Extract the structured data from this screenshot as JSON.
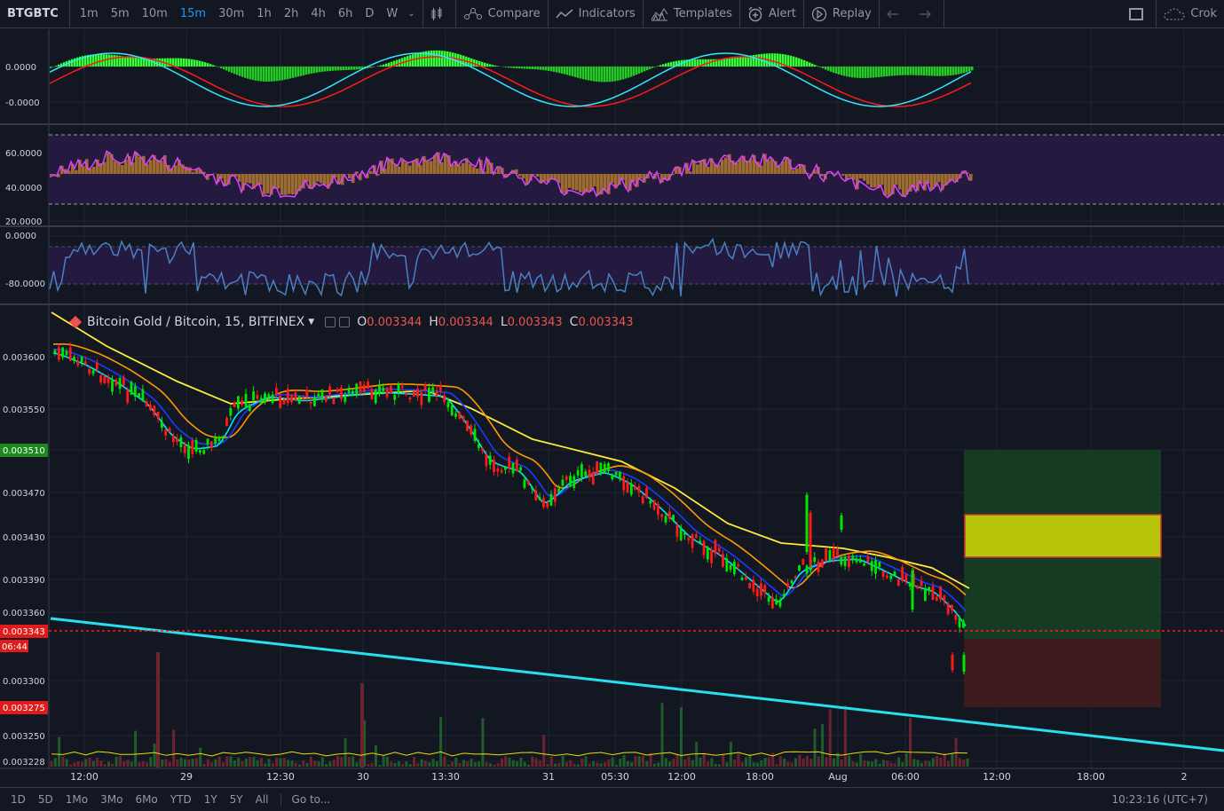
{
  "toolbar": {
    "symbol": "BTGBTC",
    "intervals": [
      "1m",
      "5m",
      "10m",
      "15m",
      "30m",
      "1h",
      "2h",
      "4h",
      "6h",
      "D",
      "W"
    ],
    "active_interval": "15m",
    "compare_label": "Compare",
    "indicators_label": "Indicators",
    "templates_label": "Templates",
    "alert_label": "Alert",
    "replay_label": "Replay",
    "right_label": "Crok"
  },
  "legend": {
    "title": "Bitcoin Gold / Bitcoin, 15, BITFINEX",
    "o_label": "O",
    "o_value": "0.003344",
    "h_label": "H",
    "h_value": "0.003344",
    "l_label": "L",
    "l_value": "0.003343",
    "c_label": "C",
    "c_value": "0.003343"
  },
  "panes": {
    "macd_labels": [
      "0.0000",
      "-0.0000"
    ],
    "rsi_labels": [
      "60.0000",
      "40.0000",
      "20.0000"
    ],
    "wr_labels": [
      "0.0000",
      "-80.0000"
    ],
    "price_labels": [
      "0.003600",
      "0.003550",
      "0.003470",
      "0.003430",
      "0.003390",
      "0.003360",
      "0.003300",
      "0.003250",
      "0.003228"
    ],
    "badge_target": "0.003510",
    "badge_last": "0.003343",
    "badge_countdown": "06:44",
    "badge_stop": "0.003275",
    "time_labels": [
      "12:00",
      "29",
      "12:30",
      "30",
      "13:30",
      "31",
      "05:30",
      "12:00",
      "18:00",
      "Aug",
      "06:00",
      "12:00",
      "18:00",
      "2"
    ]
  },
  "colors": {
    "background": "#131722",
    "up": "#00e600",
    "down": "#ff1a1a",
    "ema_fast": "#00e5ff",
    "ema_mid": "#0033ff",
    "ema_slow": "#ff9800",
    "ema_long": "#ffeb3b",
    "trendline": "#26e0f0",
    "rsi_line": "#e040fb",
    "wr_line": "#4a7fc1",
    "band_fill": "#2a1d4a"
  },
  "bottombar": {
    "ranges": [
      "1D",
      "5D",
      "1Mo",
      "3Mo",
      "6Mo",
      "YTD",
      "1Y",
      "5Y",
      "All"
    ],
    "goto": "Go to...",
    "clock": "10:23:16 (UTC+7)"
  }
}
